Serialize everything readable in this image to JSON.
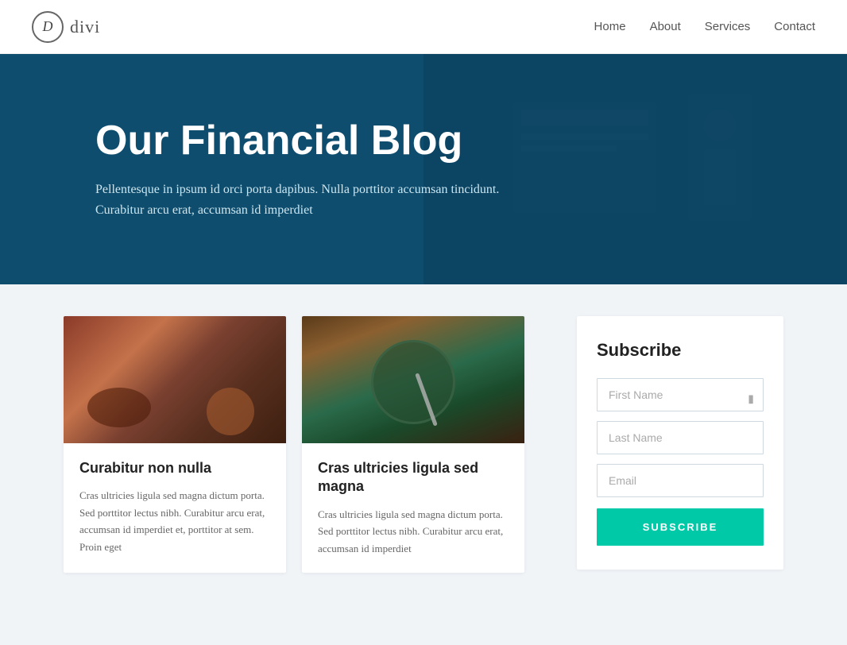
{
  "header": {
    "logo_letter": "D",
    "logo_brand": "divi",
    "nav": [
      {
        "label": "Home",
        "id": "home"
      },
      {
        "label": "About",
        "id": "about"
      },
      {
        "label": "Services",
        "id": "services"
      },
      {
        "label": "Contact",
        "id": "contact"
      }
    ]
  },
  "hero": {
    "title": "Our Financial Blog",
    "description": "Pellentesque in ipsum id orci porta dapibus. Nulla porttitor accumsan tincidunt. Curabitur arcu erat, accumsan id imperdiet"
  },
  "blog": {
    "cards": [
      {
        "id": "card-1",
        "title": "Curabitur non nulla",
        "text": "Cras ultricies ligula sed magna dictum porta. Sed porttitor lectus nibh. Curabitur arcu erat, accumsan id imperdiet et, porttitor at sem. Proin eget"
      },
      {
        "id": "card-2",
        "title": "Cras ultricies ligula sed magna",
        "text": "Cras ultricies ligula sed magna dictum porta. Sed porttitor lectus nibh. Curabitur arcu erat, accumsan id imperdiet"
      }
    ]
  },
  "sidebar": {
    "subscribe": {
      "title": "Subscribe",
      "first_name_placeholder": "First Name",
      "last_name_placeholder": "Last Name",
      "email_placeholder": "Email",
      "button_label": "SUBSCRIBE"
    }
  }
}
